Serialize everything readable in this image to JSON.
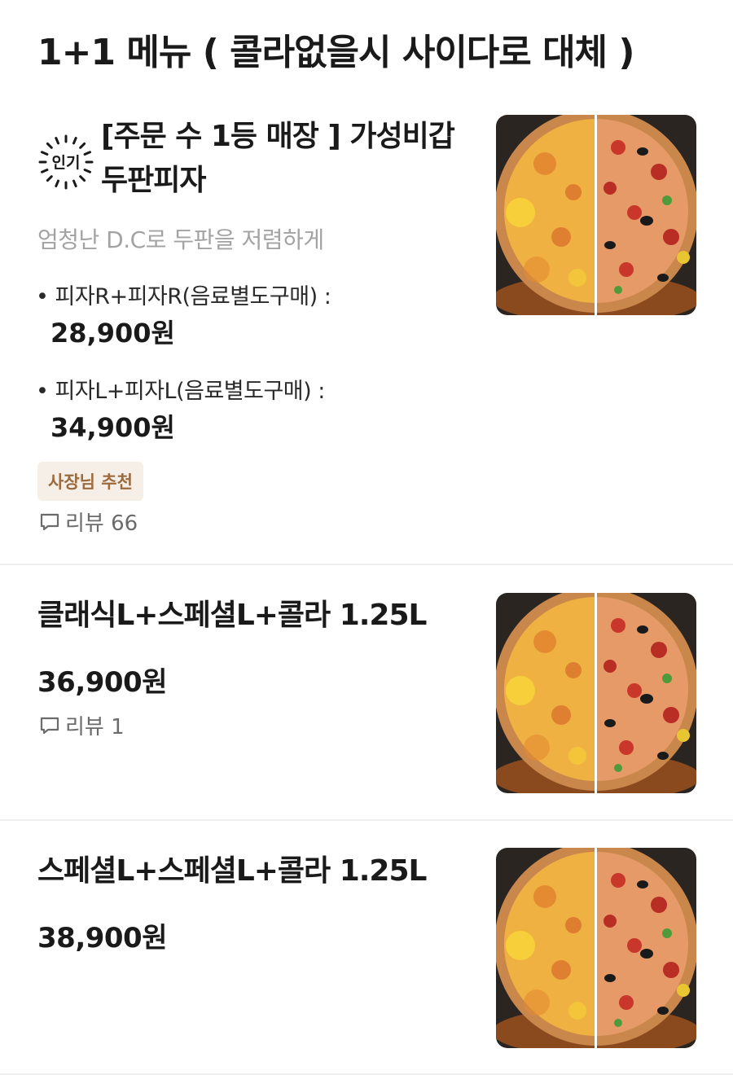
{
  "section": {
    "title": "1+1 메뉴 ( 콜라없을시 사이다로 대체 )"
  },
  "items": [
    {
      "badge": "인기",
      "name_line1": "[주문 수 1등 매장 ] 가성비갑",
      "name_line2": "두판피자",
      "description": "엄청난 D.C로 두판을 저렴하게",
      "options": [
        {
          "label": "• 피자R+피자R(음료별도구매) :",
          "price": "28,900원"
        },
        {
          "label": "• 피자L+피자L(음료별도구매) :",
          "price": "34,900원"
        }
      ],
      "tag": "사장님 추천",
      "review": "리뷰 66"
    },
    {
      "name": "클래식L+스페셜L+콜라 1.25L",
      "price": "36,900원",
      "review": "리뷰 1"
    },
    {
      "name": "스페셜L+스페셜L+콜라 1.25L",
      "price": "38,900원"
    }
  ],
  "colors": {
    "tag_bg": "#f6efe7",
    "tag_text": "#9b6a3f",
    "description": "#a3a3a3",
    "divider": "#efefef"
  },
  "icons": [
    "popular-badge-icon",
    "comment-icon",
    "pizza-photo"
  ]
}
